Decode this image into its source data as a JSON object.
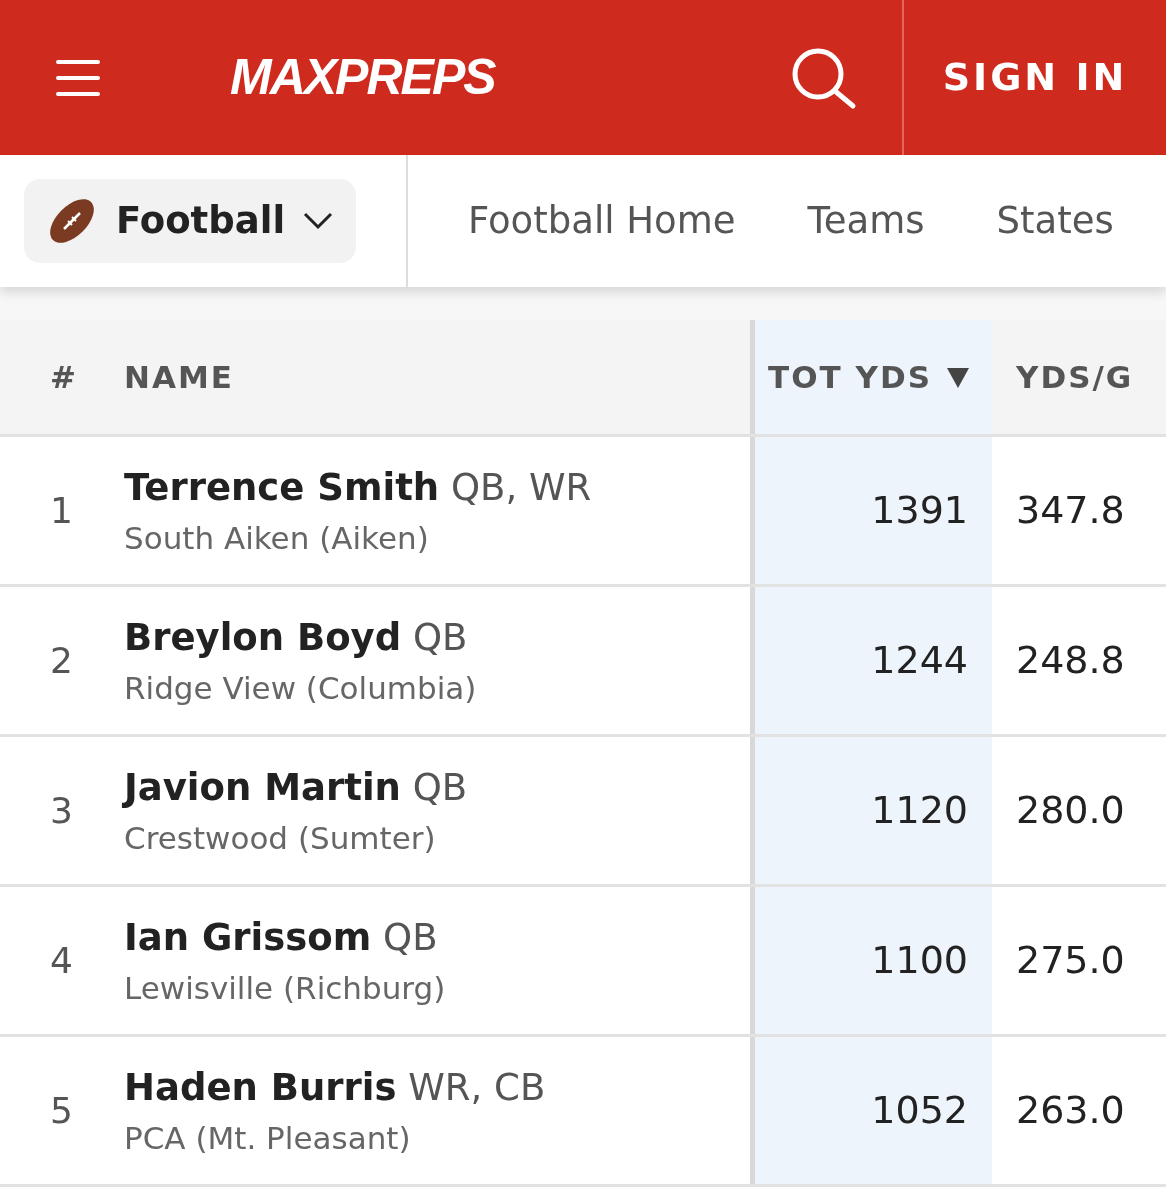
{
  "header": {
    "logo": "MAXPREPS",
    "sign_in": "SIGN IN"
  },
  "sport_selector": {
    "label": "Football"
  },
  "nav": [
    {
      "label": "Football Home"
    },
    {
      "label": "Teams"
    },
    {
      "label": "States"
    }
  ],
  "table": {
    "columns": [
      {
        "label": "#",
        "sorted": false
      },
      {
        "label": "NAME",
        "sorted": false
      },
      {
        "label": "TOT YDS",
        "sorted": true
      },
      {
        "label": "YDS/G",
        "sorted": false
      }
    ],
    "rows": [
      {
        "rank": "1",
        "name": "Terrence Smith",
        "positions": "QB, WR",
        "school": "South Aiken (Aiken)",
        "tot_yds": "1391",
        "yds_g": "347.8"
      },
      {
        "rank": "2",
        "name": "Breylon Boyd",
        "positions": "QB",
        "school": "Ridge View (Columbia)",
        "tot_yds": "1244",
        "yds_g": "248.8"
      },
      {
        "rank": "3",
        "name": "Javion Martin",
        "positions": "QB",
        "school": "Crestwood (Sumter)",
        "tot_yds": "1120",
        "yds_g": "280.0"
      },
      {
        "rank": "4",
        "name": "Ian Grissom",
        "positions": "QB",
        "school": "Lewisville (Richburg)",
        "tot_yds": "1100",
        "yds_g": "275.0"
      },
      {
        "rank": "5",
        "name": "Haden Burris",
        "positions": "WR, CB",
        "school": "PCA (Mt. Pleasant)",
        "tot_yds": "1052",
        "yds_g": "263.0"
      }
    ]
  }
}
